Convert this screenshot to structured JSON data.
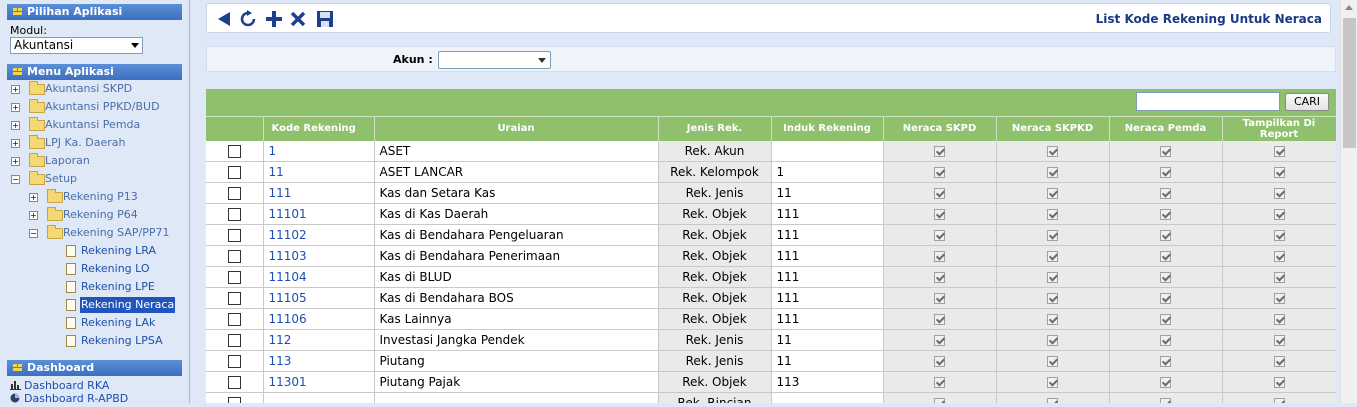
{
  "sidebar": {
    "pilihan_title": "Pilihan Aplikasi",
    "modul_label": "Modul:",
    "modul_value": "Akuntansi",
    "menu_title": "Menu Aplikasi",
    "tree": [
      {
        "label": "Akuntansi SKPD"
      },
      {
        "label": "Akuntansi PPKD/BUD"
      },
      {
        "label": "Akuntansi Pemda"
      },
      {
        "label": "LPJ Ka. Daerah"
      },
      {
        "label": "Laporan"
      },
      {
        "label": "Setup"
      },
      {
        "label": "Rekening P13"
      },
      {
        "label": "Rekening P64"
      },
      {
        "label": "Rekening SAP/PP71"
      },
      {
        "label": "Rekening LRA"
      },
      {
        "label": "Rekening LO"
      },
      {
        "label": "Rekening LPE"
      },
      {
        "label": "Rekening Neraca"
      },
      {
        "label": "Rekening LAk"
      },
      {
        "label": "Rekening LPSA"
      }
    ],
    "dashboard_title": "Dashboard",
    "dashboard_items": [
      {
        "label": "Dashboard RKA"
      },
      {
        "label": "Dashboard R-APBD"
      }
    ]
  },
  "toolbar": {
    "icons": [
      "back-icon",
      "refresh-icon",
      "add-icon",
      "delete-icon",
      "save-icon"
    ],
    "page_title": "List Kode Rekening Untuk Neraca"
  },
  "filter": {
    "akun_label": "Akun :",
    "akun_value": ""
  },
  "search": {
    "value": "",
    "button_label": "CARI"
  },
  "grid": {
    "columns": [
      "",
      "Kode Rekening",
      "Uraian",
      "Jenis Rek.",
      "Induk Rekening",
      "Neraca SKPD",
      "Neraca SKPKD",
      "Neraca Pemda",
      "Tampilkan Di Report"
    ],
    "rows": [
      {
        "kode": "1",
        "uraian": "ASET",
        "jenis": "Rek. Akun",
        "induk": ""
      },
      {
        "kode": "11",
        "uraian": "ASET LANCAR",
        "jenis": "Rek. Kelompok",
        "induk": "1"
      },
      {
        "kode": "111",
        "uraian": "Kas dan Setara Kas",
        "jenis": "Rek. Jenis",
        "induk": "11"
      },
      {
        "kode": "11101",
        "uraian": "Kas di Kas Daerah",
        "jenis": "Rek. Objek",
        "induk": "111"
      },
      {
        "kode": "11102",
        "uraian": "Kas di Bendahara Pengeluaran",
        "jenis": "Rek. Objek",
        "induk": "111"
      },
      {
        "kode": "11103",
        "uraian": "Kas di Bendahara Penerimaan",
        "jenis": "Rek. Objek",
        "induk": "111"
      },
      {
        "kode": "11104",
        "uraian": "Kas di BLUD",
        "jenis": "Rek. Objek",
        "induk": "111"
      },
      {
        "kode": "11105",
        "uraian": "Kas di Bendahara BOS",
        "jenis": "Rek. Objek",
        "induk": "111"
      },
      {
        "kode": "11106",
        "uraian": "Kas Lainnya",
        "jenis": "Rek. Objek",
        "induk": "111"
      },
      {
        "kode": "112",
        "uraian": "Investasi Jangka Pendek",
        "jenis": "Rek. Jenis",
        "induk": "11"
      },
      {
        "kode": "113",
        "uraian": "Piutang",
        "jenis": "Rek. Jenis",
        "induk": "11"
      },
      {
        "kode": "11301",
        "uraian": "Piutang Pajak",
        "jenis": "Rek. Objek",
        "induk": "113"
      },
      {
        "kode": "",
        "uraian": "",
        "jenis": "Rek. Rincian",
        "induk": ""
      }
    ]
  }
}
